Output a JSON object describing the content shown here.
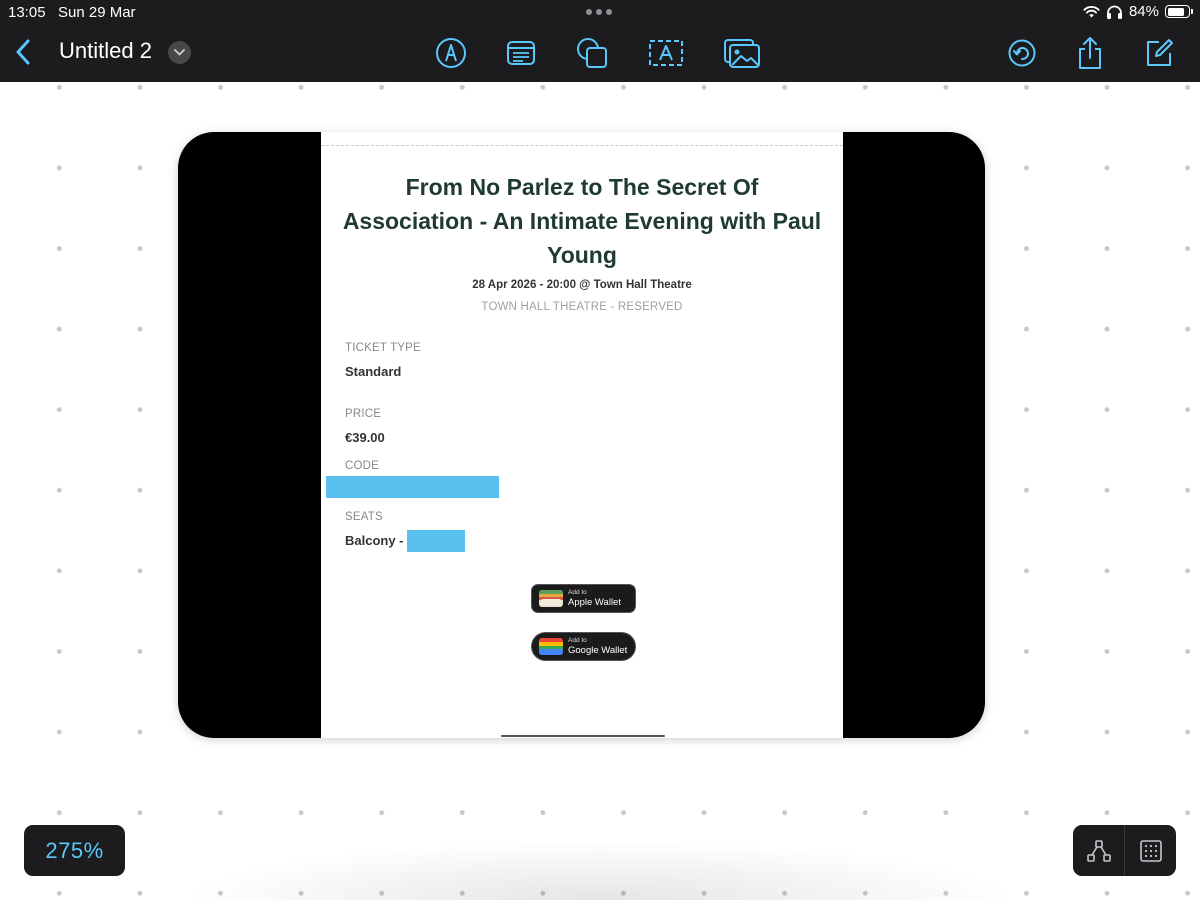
{
  "status_bar": {
    "time": "13:05",
    "date": "Sun 29 Mar",
    "battery": "84%",
    "battery_level": 0.84
  },
  "toolbar": {
    "title": "Untitled 2",
    "tools": [
      "pen-tool-icon",
      "text-box-icon",
      "shapes-icon",
      "text-frame-icon",
      "media-icon"
    ],
    "right": [
      "undo-icon",
      "share-icon",
      "new-document-icon"
    ],
    "accent": "#5ac8fa"
  },
  "ticket": {
    "title": "From No Parlez to The Secret Of Association - An Intimate Evening with Paul Young",
    "date_line": "28 Apr 2026 - 20:00 @ Town Hall Theatre",
    "venue": "TOWN HALL THEATRE - RESERVED",
    "ticket_type_label": "TICKET TYPE",
    "ticket_type_value": "Standard",
    "price_label": "PRICE",
    "price_value": "€39.00",
    "code_label": "CODE",
    "seats_label": "SEATS",
    "seats_value": "Balcony -",
    "apple_wallet_small": "Add to",
    "apple_wallet_big": "Apple Wallet",
    "google_wallet_small": "Add to",
    "google_wallet_big": "Google Wallet",
    "redaction_color": "#5ac0f0"
  },
  "zoom": {
    "label": "275%"
  },
  "bottom_tools": [
    "connector-icon",
    "grid-icon"
  ]
}
